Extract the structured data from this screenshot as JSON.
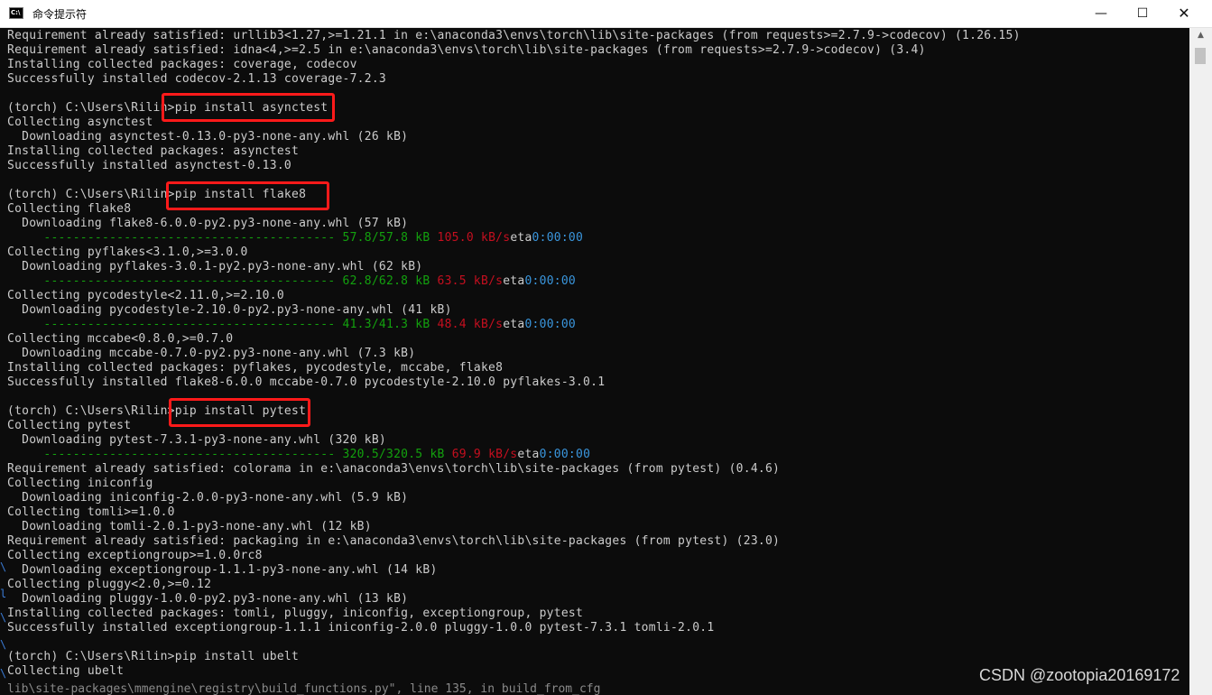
{
  "window": {
    "title": "命令提示符",
    "icon_text": "C:\\",
    "minimize": "—",
    "maximize": "☐",
    "close": "✕"
  },
  "console": {
    "lines": [
      {
        "text": "Requirement already satisfied: urllib3<1.27,>=1.21.1 in e:\\anaconda3\\envs\\torch\\lib\\site-packages (from requests>=2.7.9->codecov) (1.26.15)"
      },
      {
        "text": "Requirement already satisfied: idna<4,>=2.5 in e:\\anaconda3\\envs\\torch\\lib\\site-packages (from requests>=2.7.9->codecov) (3.4)"
      },
      {
        "text": "Installing collected packages: coverage, codecov"
      },
      {
        "text": "Successfully installed codecov-2.1.13 coverage-7.2.3"
      },
      {
        "text": ""
      },
      {
        "text": "(torch) C:\\Users\\Rilin>pip install asynctest"
      },
      {
        "text": "Collecting asynctest"
      },
      {
        "text": "  Downloading asynctest-0.13.0-py3-none-any.whl (26 kB)"
      },
      {
        "text": "Installing collected packages: asynctest"
      },
      {
        "text": "Successfully installed asynctest-0.13.0"
      },
      {
        "text": ""
      },
      {
        "text": "(torch) C:\\Users\\Rilin>pip install flake8"
      },
      {
        "text": "Collecting flake8"
      },
      {
        "text": "  Downloading flake8-6.0.0-py2.py3-none-any.whl (57 kB)"
      },
      {
        "bar": "     ---------------------------------------- ",
        "progress": "57.8/57.8 kB",
        "rate": "105.0 kB/s",
        "eta_label": "eta",
        "eta": "0:00:00"
      },
      {
        "text": "Collecting pyflakes<3.1.0,>=3.0.0"
      },
      {
        "text": "  Downloading pyflakes-3.0.1-py2.py3-none-any.whl (62 kB)"
      },
      {
        "bar": "     ---------------------------------------- ",
        "progress": "62.8/62.8 kB",
        "rate": "63.5 kB/s",
        "eta_label": "eta",
        "eta": "0:00:00"
      },
      {
        "text": "Collecting pycodestyle<2.11.0,>=2.10.0"
      },
      {
        "text": "  Downloading pycodestyle-2.10.0-py2.py3-none-any.whl (41 kB)"
      },
      {
        "bar": "     ---------------------------------------- ",
        "progress": "41.3/41.3 kB",
        "rate": "48.4 kB/s",
        "eta_label": "eta",
        "eta": "0:00:00"
      },
      {
        "text": "Collecting mccabe<0.8.0,>=0.7.0"
      },
      {
        "text": "  Downloading mccabe-0.7.0-py2.py3-none-any.whl (7.3 kB)"
      },
      {
        "text": "Installing collected packages: pyflakes, pycodestyle, mccabe, flake8"
      },
      {
        "text": "Successfully installed flake8-6.0.0 mccabe-0.7.0 pycodestyle-2.10.0 pyflakes-3.0.1"
      },
      {
        "text": ""
      },
      {
        "text": "(torch) C:\\Users\\Rilin>pip install pytest"
      },
      {
        "text": "Collecting pytest"
      },
      {
        "text": "  Downloading pytest-7.3.1-py3-none-any.whl (320 kB)"
      },
      {
        "bar": "     ---------------------------------------- ",
        "progress": "320.5/320.5 kB",
        "rate": "69.9 kB/s",
        "eta_label": "eta",
        "eta": "0:00:00"
      },
      {
        "text": "Requirement already satisfied: colorama in e:\\anaconda3\\envs\\torch\\lib\\site-packages (from pytest) (0.4.6)"
      },
      {
        "text": "Collecting iniconfig"
      },
      {
        "text": "  Downloading iniconfig-2.0.0-py3-none-any.whl (5.9 kB)"
      },
      {
        "text": "Collecting tomli>=1.0.0"
      },
      {
        "text": "  Downloading tomli-2.0.1-py3-none-any.whl (12 kB)"
      },
      {
        "text": "Requirement already satisfied: packaging in e:\\anaconda3\\envs\\torch\\lib\\site-packages (from pytest) (23.0)"
      },
      {
        "text": "Collecting exceptiongroup>=1.0.0rc8"
      },
      {
        "text": "  Downloading exceptiongroup-1.1.1-py3-none-any.whl (14 kB)"
      },
      {
        "text": "Collecting pluggy<2.0,>=0.12"
      },
      {
        "text": "  Downloading pluggy-1.0.0-py2.py3-none-any.whl (13 kB)"
      },
      {
        "text": "Installing collected packages: tomli, pluggy, iniconfig, exceptiongroup, pytest"
      },
      {
        "text": "Successfully installed exceptiongroup-1.1.1 iniconfig-2.0.0 pluggy-1.0.0 pytest-7.3.1 tomli-2.0.1"
      },
      {
        "text": ""
      },
      {
        "text": "(torch) C:\\Users\\Rilin>pip install ubelt"
      },
      {
        "text": "Collecting ubelt"
      }
    ],
    "underlay_text": "lib\\site-packages\\mmengine\\registry\\build_functions.py\", line 135, in build_from_cfg",
    "colors": {
      "text": "#cccccc",
      "progress": "#13a10e",
      "rate": "#c50f1f",
      "eta": "#3a96dd",
      "highlight": "#ff1a1a"
    }
  },
  "scrollbar": {
    "up_arrow": "▲"
  },
  "watermark": "CSDN @zootopia20169172"
}
